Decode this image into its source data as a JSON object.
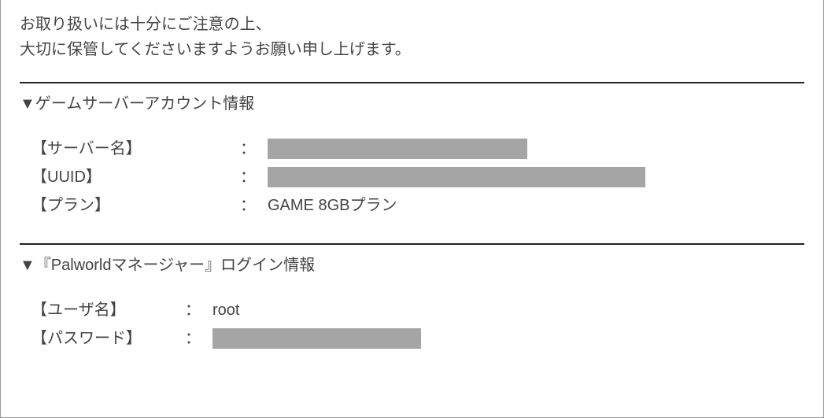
{
  "intro": {
    "line1": "お取り扱いには十分にご注意の上、",
    "line2": "大切に保管してくださいますようお願い申し上げます。"
  },
  "section1": {
    "heading": "▼ゲームサーバーアカウント情報",
    "rows": [
      {
        "label": "【サーバー名】",
        "colon": "：",
        "value": "",
        "redacted": true,
        "redactClass": "redacted-server"
      },
      {
        "label": "【UUID】",
        "colon": "：",
        "value": "",
        "redacted": true,
        "redactClass": "redacted-uuid"
      },
      {
        "label": "【プラン】",
        "colon": "：",
        "value": "GAME 8GBプラン",
        "redacted": false
      }
    ]
  },
  "section2": {
    "heading": "▼『Palworldマネージャー』ログイン情報",
    "rows": [
      {
        "label": "【ユーザ名】",
        "colon": "：",
        "value": "root",
        "redacted": false
      },
      {
        "label": "【パスワード】",
        "colon": "：",
        "value": "",
        "redacted": true,
        "redactClass": "redacted-password"
      }
    ]
  }
}
